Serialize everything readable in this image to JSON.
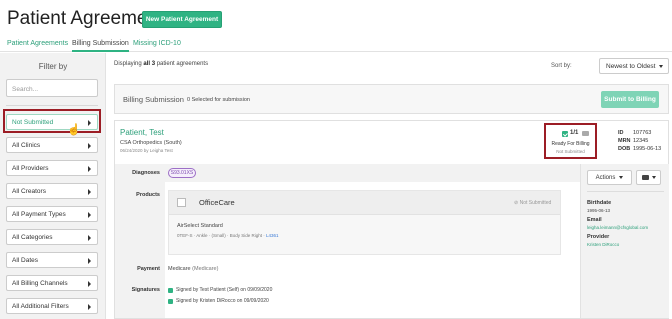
{
  "header": {
    "title": "Patient Agreements",
    "new_button": "New Patient Agreement"
  },
  "tabs": [
    {
      "label": "Patient Agreements",
      "active": false
    },
    {
      "label": "Billing Submission",
      "active": true
    },
    {
      "label": "Missing ICD-10",
      "active": false
    }
  ],
  "sidebar": {
    "title": "Filter by",
    "search_placeholder": "Search...",
    "filters": [
      "Not Submitted",
      "All Clinics",
      "All Providers",
      "All Creators",
      "All Payment Types",
      "All Categories",
      "All Dates",
      "All Billing Channels",
      "All Additional Filters"
    ]
  },
  "list": {
    "display_prefix": "Displaying ",
    "display_bold": "all 3",
    "display_suffix": " patient agreements",
    "sort_label": "Sort by:",
    "sort_value": "Newest to Oldest"
  },
  "submission": {
    "title": "Billing Submission",
    "selected": "0 Selected for submission",
    "submit_button": "Submit to Billing"
  },
  "agreement": {
    "patient_name": "Patient, Test",
    "clinic": "CSA Orthopedics (South)",
    "date_by": "06/24/2020 by Leigha Test",
    "ready_count": "1/1",
    "ready_status": "Ready For Billing",
    "submit_status": "Not Submitted",
    "id_label": "ID",
    "id_value": "107763",
    "mrn_label": "MRN",
    "mrn_value": "12345",
    "dob_label": "DOB",
    "dob_value": "1995-06-13",
    "labels": {
      "diagnoses": "Diagnoses",
      "products": "Products",
      "payment": "Payment",
      "signatures": "Signatures"
    },
    "diagnosis_code": "S93.01XS",
    "product": {
      "vendor": "OfficeCare",
      "status": "Not Submitted",
      "name": "AirSelect Standard",
      "details": "0TEF-S · Ankle · (Small) · Body Side Right ·",
      "code": "L4361"
    },
    "payment_main": "Medicare",
    "payment_sub": "(Medicare)",
    "signatures": [
      "Signed by Test Patient (Self) on 09/09/2020",
      "Signed by Kristen DiRocco on 09/09/2020"
    ],
    "actions_label": "Actions",
    "birthdate_label": "Birthdate",
    "birthdate_value": "1995-06-13",
    "email_label": "Email",
    "email_value": "leigha.leimann@cfsglobal.com",
    "provider_label": "Provider",
    "provider_value": "Kristen DiRocco"
  },
  "colors": {
    "accent": "#2fb383",
    "highlight": "#9c1d25",
    "diagnosis": "#7d4bb0"
  }
}
